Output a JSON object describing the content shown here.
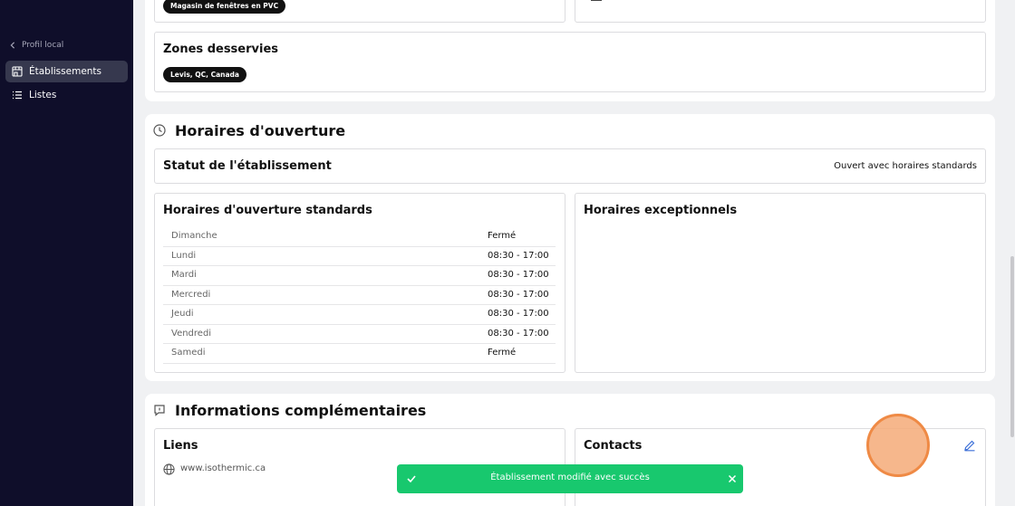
{
  "sidebar": {
    "back_label": "Profil local",
    "items": [
      {
        "label": "Établissements",
        "icon": "store-icon",
        "active": true
      },
      {
        "label": "Listes",
        "icon": "list-icon",
        "active": false
      }
    ]
  },
  "top": {
    "category_pill": "Magasin de fenêtres en PVC"
  },
  "zones": {
    "title": "Zones desservies",
    "pill": "Levis, QC, Canada"
  },
  "hours": {
    "section_title": "Horaires d'ouverture",
    "status_label": "Statut de l'établissement",
    "status_value": "Ouvert avec horaires standards",
    "standard_title": "Horaires d'ouverture standards",
    "exceptional_title": "Horaires exceptionnels",
    "rows": [
      {
        "day": "Dimanche",
        "time": "Fermé"
      },
      {
        "day": "Lundi",
        "time": "08:30 - 17:00"
      },
      {
        "day": "Mardi",
        "time": "08:30 - 17:00"
      },
      {
        "day": "Mercredi",
        "time": "08:30 - 17:00"
      },
      {
        "day": "Jeudi",
        "time": "08:30 - 17:00"
      },
      {
        "day": "Vendredi",
        "time": "08:30 - 17:00"
      },
      {
        "day": "Samedi",
        "time": "Fermé"
      }
    ]
  },
  "info": {
    "section_title": "Informations complémentaires",
    "links_title": "Liens",
    "website": "www.isothermic.ca",
    "contacts_title": "Contacts"
  },
  "toast": {
    "message": "Établissement modifié avec succès"
  },
  "colors": {
    "sidebar_bg": "#0f0e2a",
    "toast_bg": "#18c86e",
    "accent": "#3b6fd8"
  }
}
